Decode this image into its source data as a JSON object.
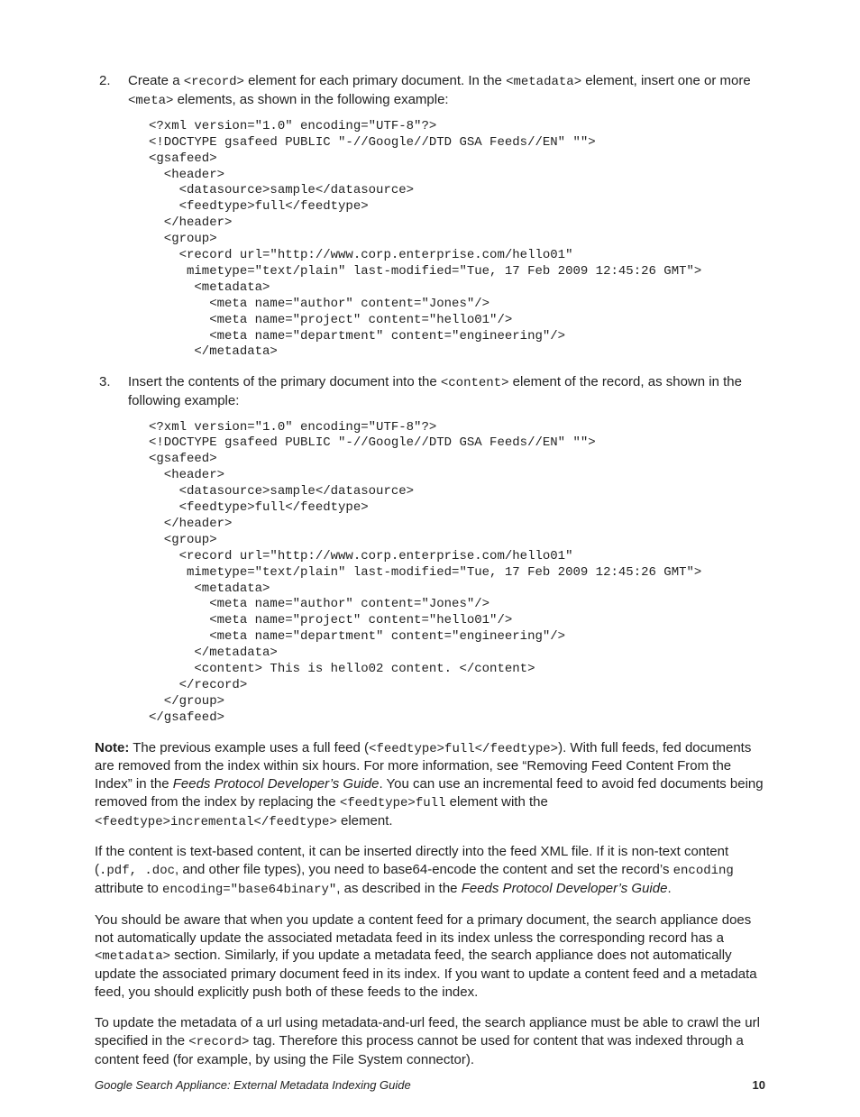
{
  "step2": {
    "num": "2.",
    "t1": "Create a ",
    "c1": "<record>",
    "t2": " element for each primary document. In the ",
    "c2": "<metadata>",
    "t3": " element, insert one or more ",
    "c3": "<meta>",
    "t4": " elements, as shown in the following example:"
  },
  "code1": "<?xml version=\"1.0\" encoding=\"UTF-8\"?>\n<!DOCTYPE gsafeed PUBLIC \"-//Google//DTD GSA Feeds//EN\" \"\">\n<gsafeed>\n  <header>\n    <datasource>sample</datasource>\n    <feedtype>full</feedtype>\n  </header>\n  <group>\n    <record url=\"http://www.corp.enterprise.com/hello01\"\n     mimetype=\"text/plain\" last-modified=\"Tue, 17 Feb 2009 12:45:26 GMT\">\n      <metadata>\n        <meta name=\"author\" content=\"Jones\"/>\n        <meta name=\"project\" content=\"hello01\"/>\n        <meta name=\"department\" content=\"engineering\"/>\n      </metadata>",
  "step3": {
    "num": "3.",
    "t1": "Insert the contents of the primary document into the ",
    "c1": "<content>",
    "t2": " element of the record, as shown in the following example:"
  },
  "code2": "<?xml version=\"1.0\" encoding=\"UTF-8\"?>\n<!DOCTYPE gsafeed PUBLIC \"-//Google//DTD GSA Feeds//EN\" \"\">\n<gsafeed>\n  <header>\n    <datasource>sample</datasource>\n    <feedtype>full</feedtype>\n  </header>\n  <group>\n    <record url=\"http://www.corp.enterprise.com/hello01\"\n     mimetype=\"text/plain\" last-modified=\"Tue, 17 Feb 2009 12:45:26 GMT\">\n      <metadata>\n        <meta name=\"author\" content=\"Jones\"/>\n        <meta name=\"project\" content=\"hello01\"/>\n        <meta name=\"department\" content=\"engineering\"/>\n      </metadata>\n      <content> This is hello02 content. </content>\n    </record>\n  </group>\n</gsafeed>",
  "note": {
    "label": "Note:",
    "t1": "  The previous example uses a full feed (",
    "c1": "<feedtype>full</feedtype>",
    "t2": "). With full feeds, fed documents are removed from the index within six hours. For more information, see “Removing Feed Content From the Index” in the ",
    "i1": "Feeds Protocol Developer’s Guide",
    "t3": ". You can use an incremental feed to avoid fed documents being removed from the index by replacing the ",
    "c2": "<feedtype>full",
    "t4": " element with the ",
    "c3": "<feedtype>incremental</feedtype>",
    "t5": " element."
  },
  "p_text": {
    "t1": "If the content is text-based content, it can be inserted directly into the feed XML file. If it is non-text content (",
    "c1": ".pdf, .doc",
    "t2": ", and other file types), you need to base64-encode the content and set the record’s ",
    "c2": "encoding",
    "t3": " attribute to ",
    "c3": "encoding=\"base64binary\"",
    "t4": ", as described in the ",
    "i1": "Feeds Protocol Developer’s Guide",
    "t5": "."
  },
  "p_aware": {
    "t1": "You should be aware that when you update a content feed for a primary document, the search appliance does not automatically update the associated metadata feed in its index unless the corresponding record has a ",
    "c1": "<metadata>",
    "t2": " section. Similarly, if you update a metadata feed, the search appliance does not automatically update the associated primary document feed in its index. If you want to update a content feed and a metadata feed, you should explicitly push both of these feeds to the index."
  },
  "p_update": {
    "t1": "To update the metadata of a url using metadata-and-url feed, the search appliance must be able to crawl the url specified in the ",
    "c1": "<record>",
    "t2": " tag. Therefore this process cannot be used for content that was indexed through a content feed (for example, by using the File System connector)."
  },
  "footer": {
    "title": "Google Search Appliance: External Metadata Indexing Guide",
    "page": "10"
  }
}
